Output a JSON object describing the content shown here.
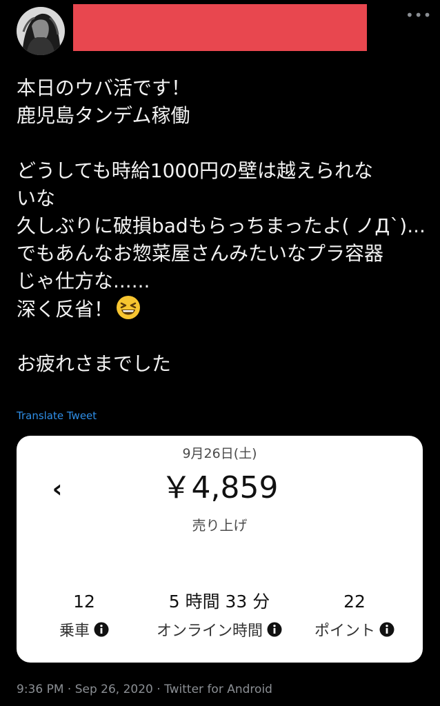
{
  "header": {
    "more_label": "•••"
  },
  "tweet": {
    "lines": [
      "本日のウバ活です！",
      "鹿児島タンデム稼働",
      "",
      "どうしても時給1000円の壁は越えられな",
      "いな",
      "久しぶりに破損badもらっちまったよ( ノД`)...",
      "でもあんなお惣菜屋さんみたいなプラ容器",
      "じゃ仕方な......",
      "深く反省！",
      "",
      "お疲れさまでした"
    ],
    "emoji": "grinning-squinting-face",
    "translate_label": "Translate Tweet",
    "meta": "9:36 PM · Sep 26, 2020 · Twitter for Android"
  },
  "card": {
    "date": "9月26日(土)",
    "back_symbol": "‹",
    "amount": "￥4,859",
    "sales_label": "売り上げ",
    "stats": [
      {
        "value": "12",
        "label": "乗車"
      },
      {
        "value": "5 時間 33 分",
        "label": "オンライン時間"
      },
      {
        "value": "22",
        "label": "ポイント"
      }
    ]
  },
  "colors": {
    "background": "#000000",
    "text": "#f2f2f2",
    "link": "#2f8fe8",
    "redaction": "#e8474f",
    "card": "#ffffff",
    "muted": "#8b8f94"
  }
}
